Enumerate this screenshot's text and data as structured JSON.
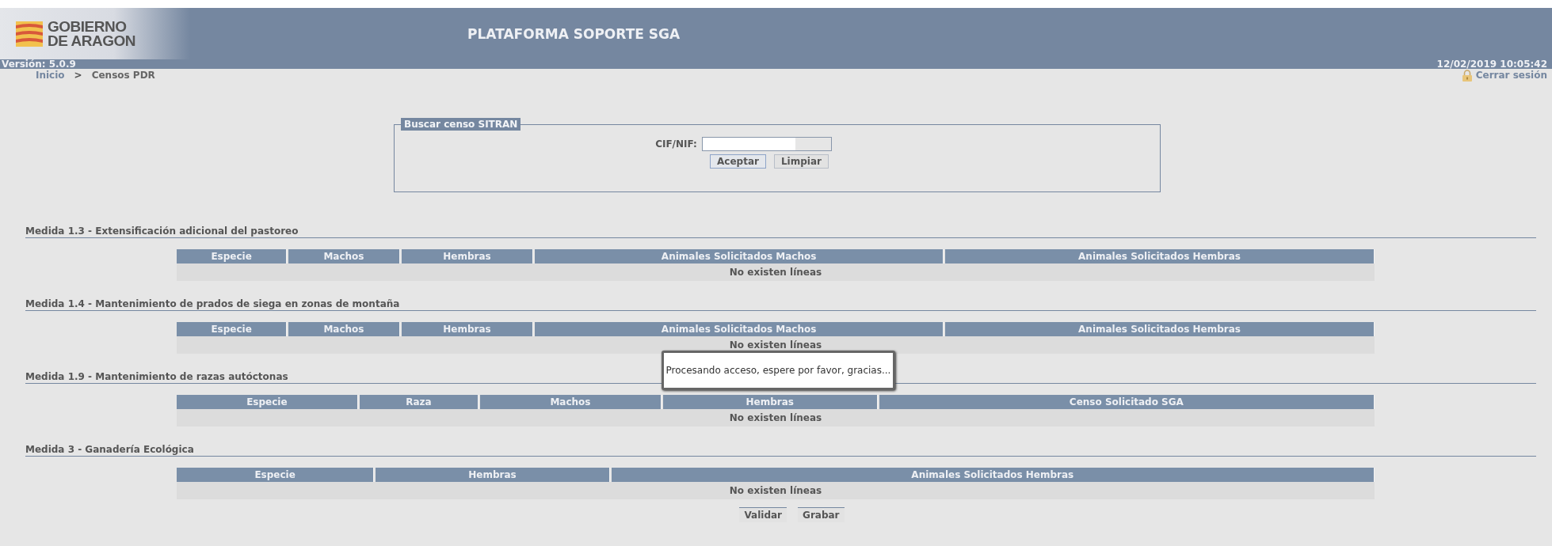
{
  "header": {
    "logo_text": [
      "GOBIERNO",
      "DE ARAGON"
    ],
    "title": "PLATAFORMA SOPORTE SGA",
    "version": "Versión: 5.0.9",
    "datetime": "12/02/2019 10:05:42"
  },
  "breadcrumb": {
    "items": [
      "Inicio",
      "Censos PDR"
    ],
    "separator": ">"
  },
  "logout": {
    "label": "Cerrar sesión"
  },
  "search": {
    "legend": "Buscar censo SITRAN",
    "field_label": "CIF/NIF:",
    "buttons": [
      "Aceptar",
      "Limpiar"
    ]
  },
  "sections": [
    {
      "title": "Medida 1.3 - Extensificación adicional del pastoreo",
      "columns": [
        "Especie",
        "Machos",
        "Hembras",
        "Animales Solicitados Machos",
        "Animales Solicitados Hembras"
      ],
      "empty_text": "No existen líneas"
    },
    {
      "title": "Medida 1.4 - Mantenimiento de prados de siega en zonas de montaña",
      "columns": [
        "Especie",
        "Machos",
        "Hembras",
        "Animales Solicitados Machos",
        "Animales Solicitados Hembras"
      ],
      "empty_text": "No existen líneas"
    },
    {
      "title": "Medida 1.9 - Mantenimiento de razas autóctonas",
      "columns": [
        "Especie",
        "Raza",
        "Machos",
        "Hembras",
        "Censo Solicitado SGA"
      ],
      "empty_text": "No existen líneas"
    },
    {
      "title": "Medida 3 - Ganadería Ecológica",
      "columns": [
        "Especie",
        "Hembras",
        "Animales Solicitados Hembras"
      ],
      "empty_text": "No existen líneas"
    }
  ],
  "actions": [
    "Validar",
    "Grabar"
  ],
  "loading_dialog": {
    "message": "Procesando acceso, espere por favor, gracias..."
  }
}
